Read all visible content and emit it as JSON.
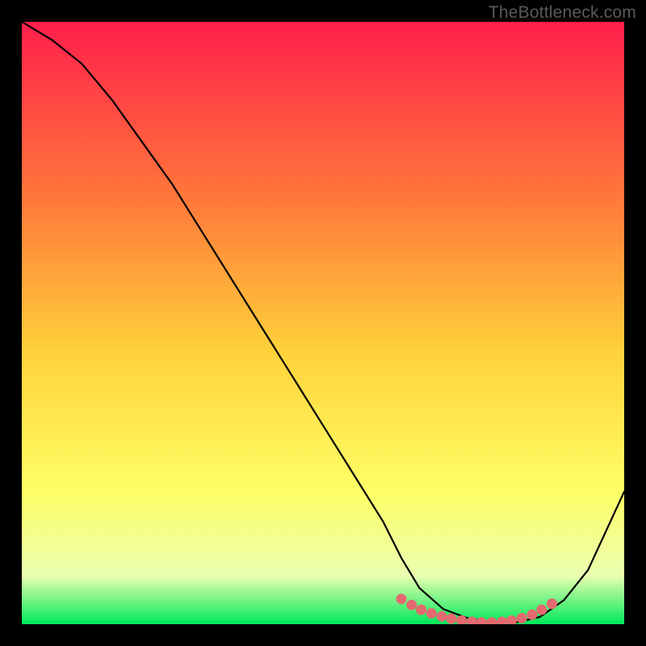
{
  "watermark": "TheBottleneck.com",
  "colors": {
    "bg": "#000000",
    "grad_top": "#ff1f4b",
    "grad_mid1": "#ff7a3a",
    "grad_mid2": "#ffd23a",
    "grad_mid3": "#ffff66",
    "grad_mid4": "#e9ffb0",
    "grad_bottom": "#00e85a",
    "curve": "#000000",
    "marker": "#e46a6f"
  },
  "chart_data": {
    "type": "line",
    "title": "",
    "xlabel": "",
    "ylabel": "",
    "xlim": [
      0,
      100
    ],
    "ylim": [
      0,
      100
    ],
    "grid": false,
    "legend": false,
    "series": [
      {
        "name": "bottleneck-curve",
        "x": [
          0,
          5,
          10,
          15,
          20,
          25,
          30,
          35,
          40,
          45,
          50,
          55,
          60,
          63,
          66,
          70,
          74,
          78,
          82,
          86,
          90,
          94,
          100
        ],
        "y": [
          100,
          97,
          93,
          87,
          80,
          73,
          65,
          57,
          49,
          41,
          33,
          25,
          17,
          11,
          6,
          2.5,
          1,
          0.3,
          0.3,
          1.2,
          4,
          9,
          22
        ]
      }
    ],
    "markers": {
      "name": "valley-cluster",
      "x": [
        63,
        64.7,
        66.3,
        68,
        69.7,
        71.3,
        73,
        74.7,
        76.3,
        78,
        79.7,
        81.3,
        83,
        84.7,
        86.3,
        88
      ],
      "y": [
        4.2,
        3.2,
        2.4,
        1.8,
        1.3,
        0.9,
        0.6,
        0.4,
        0.3,
        0.3,
        0.4,
        0.6,
        1.0,
        1.6,
        2.4,
        3.4
      ]
    },
    "annotations": []
  }
}
